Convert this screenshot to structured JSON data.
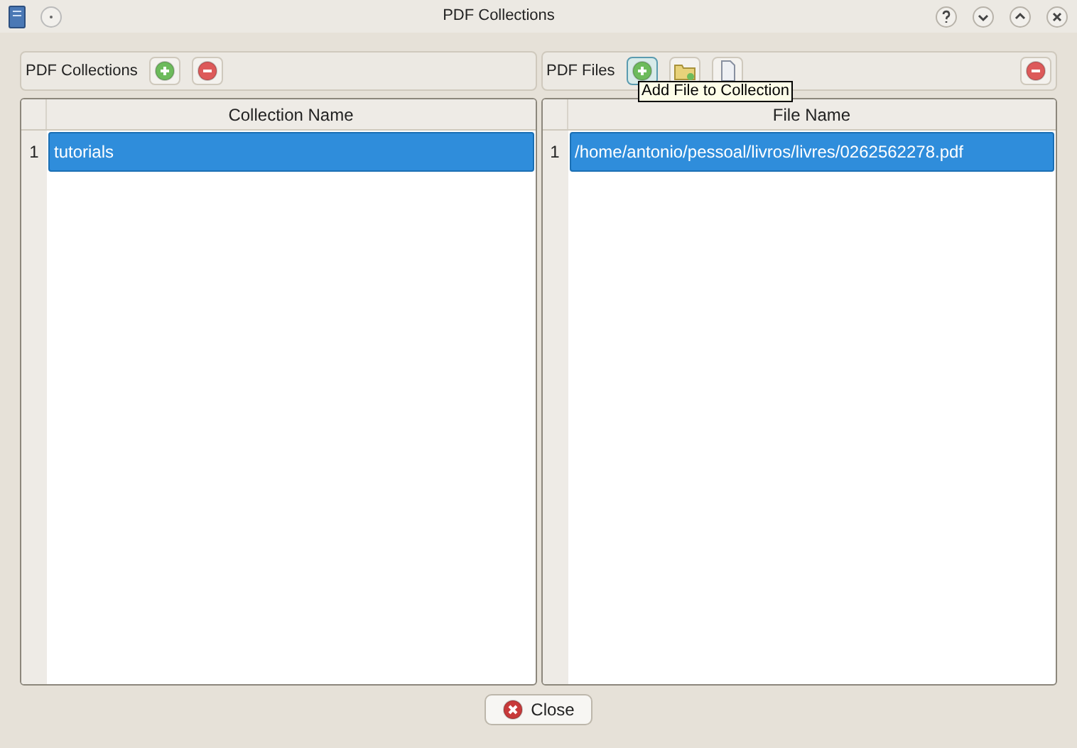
{
  "window": {
    "title": "PDF Collections"
  },
  "collections_panel": {
    "label": "PDF Collections",
    "column": "Collection Name",
    "rows": [
      {
        "number": "1",
        "name": "tutorials",
        "selected": true
      }
    ]
  },
  "files_panel": {
    "label": "PDF Files",
    "column": "File Name",
    "tooltip": "Add File to Collection",
    "rows": [
      {
        "number": "1",
        "name": "/home/antonio/pessoal/livros/livres/0262562278.pdf",
        "selected": true
      }
    ]
  },
  "buttons": [
    {
      "label": "Close"
    }
  ]
}
